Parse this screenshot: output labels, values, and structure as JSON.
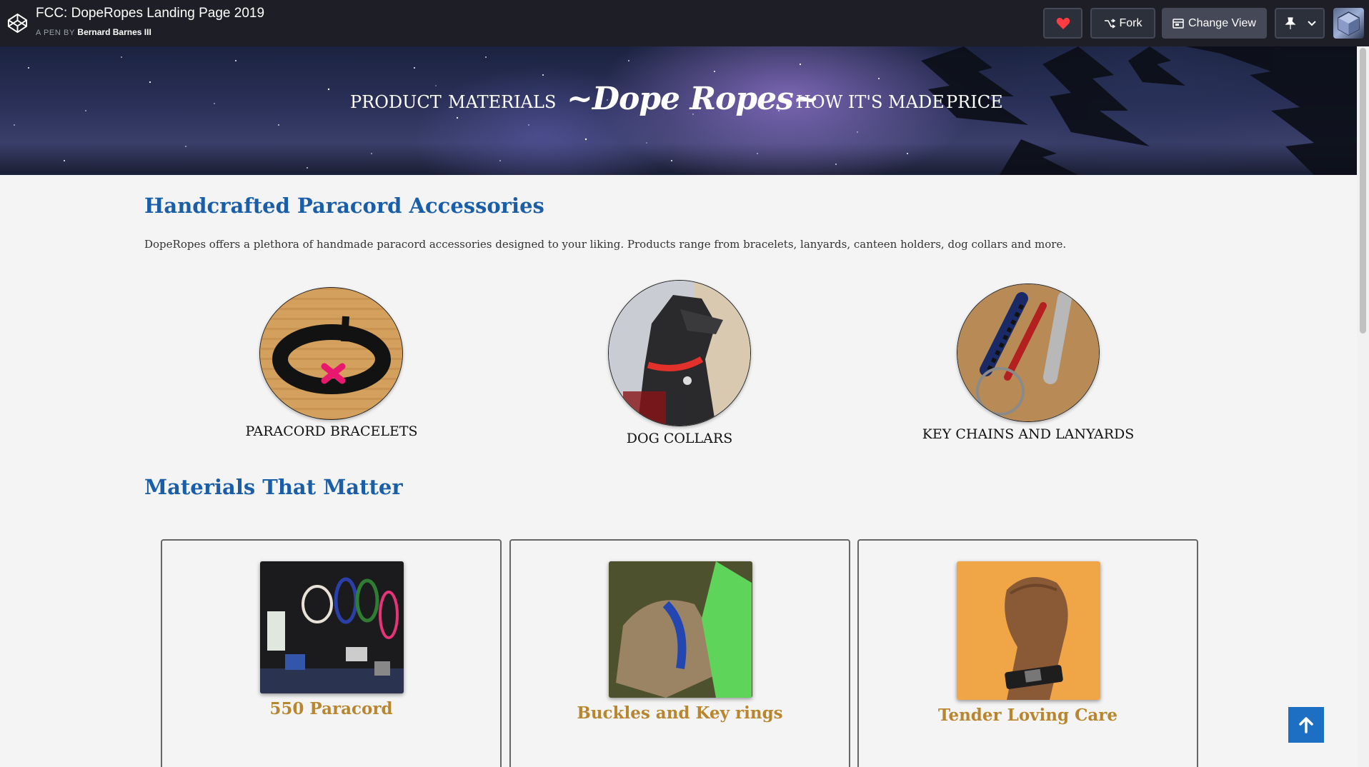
{
  "codepen": {
    "title": "FCC: DopeRopes Landing Page 2019",
    "byline_prefix": "A PEN BY",
    "author": "Bernard Barnes III",
    "fork_label": "Fork",
    "change_view_label": "Change View"
  },
  "nav": {
    "brand": "~Dope Ropes~",
    "links": [
      "PRODUCT",
      "MATERIALS",
      "HOW IT'S MADE",
      "PRICE"
    ]
  },
  "products_section": {
    "heading": "Handcrafted Paracord Accessories",
    "intro": "DopeRopes offers a plethora of handmade paracord accessories designed to your liking. Products range from bracelets, lanyards, canteen holders, dog collars and more.",
    "items": [
      {
        "label": "PARACORD BRACELETS",
        "image": "bracelet-photo"
      },
      {
        "label": "DOG COLLARS",
        "image": "dog-collar-photo"
      },
      {
        "label": "KEY CHAINS AND LANYARDS",
        "image": "keychain-photo"
      }
    ]
  },
  "materials_section": {
    "heading": "Materials That Matter",
    "cards": [
      {
        "title": "550 Paracord",
        "image": "paracord-spools-photo"
      },
      {
        "title": "Buckles and Key rings",
        "image": "dog-green-harness-photo"
      },
      {
        "title": "Tender Loving Care",
        "image": "wrist-bracelet-photo"
      }
    ]
  },
  "colors": {
    "heading_blue": "#1a5ea8",
    "card_title_gold": "#b8862f",
    "to_top_blue": "#1d6fc4",
    "codepen_bar": "#1e1f26"
  }
}
